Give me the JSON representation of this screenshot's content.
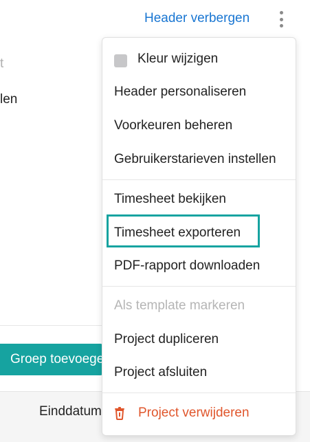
{
  "header": {
    "hide_header_label": "Header verbergen",
    "more_icon": "vertical-ellipsis-icon"
  },
  "background": {
    "fragment_1": "t",
    "fragment_2": "len",
    "group_button_label": "Groep toevoegen",
    "column_einddatum": "Einddatum"
  },
  "menu": {
    "change_color": {
      "label": "Kleur wijzigen",
      "swatch_color": "#c7c7c9"
    },
    "personalize_header": "Header personaliseren",
    "manage_preferences": "Voorkeuren beheren",
    "set_user_rates": "Gebruikerstarieven instellen",
    "view_timesheet": "Timesheet bekijken",
    "export_timesheet": "Timesheet exporteren",
    "download_pdf": "PDF-rapport downloaden",
    "mark_template": "Als template markeren",
    "duplicate_project": "Project dupliceren",
    "close_project": "Project afsluiten",
    "delete_project": {
      "label": "Project verwijderen",
      "icon": "trash-icon",
      "color": "#e0562c"
    }
  },
  "colors": {
    "accent": "#16a3a0",
    "link": "#1976d2",
    "danger": "#e0562c"
  }
}
